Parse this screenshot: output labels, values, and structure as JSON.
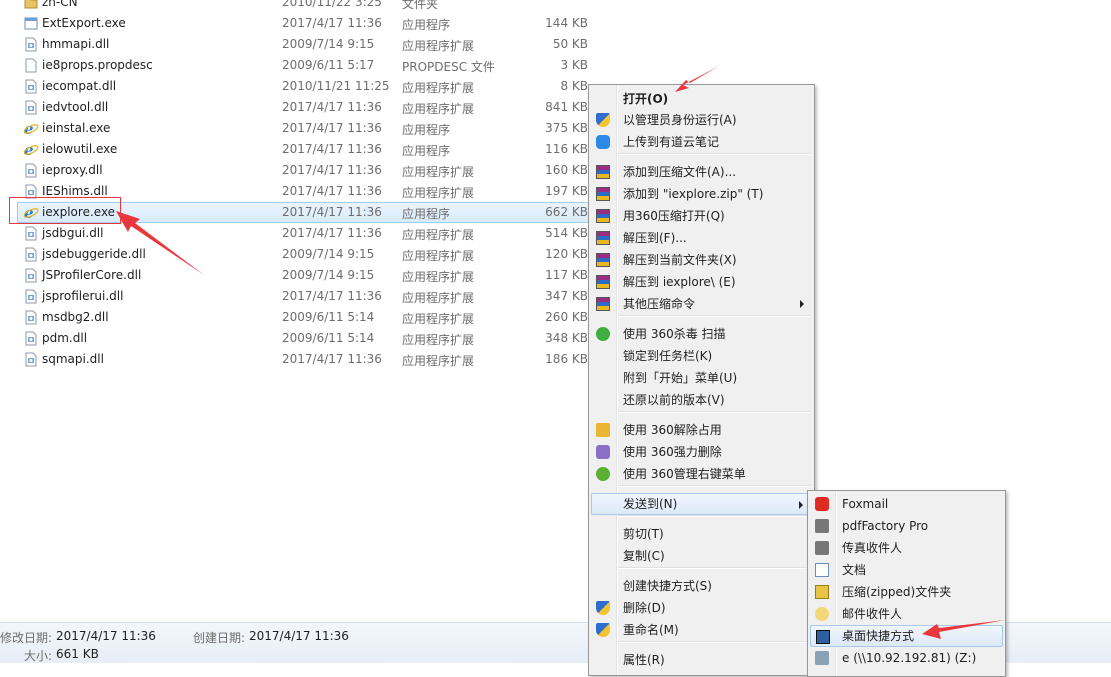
{
  "files": [
    {
      "name": "zh-CN",
      "date": "2010/11/22 3:25",
      "type": "文件夹",
      "size": "",
      "icon": "folder-icon"
    },
    {
      "name": "ExtExport.exe",
      "date": "2017/4/17 11:36",
      "type": "应用程序",
      "size": "144 KB",
      "icon": "exe-icon"
    },
    {
      "name": "hmmapi.dll",
      "date": "2009/7/14 9:15",
      "type": "应用程序扩展",
      "size": "50 KB",
      "icon": "dll-icon"
    },
    {
      "name": "ie8props.propdesc",
      "date": "2009/6/11 5:17",
      "type": "PROPDESC 文件",
      "size": "3 KB",
      "icon": "file-icon"
    },
    {
      "name": "iecompat.dll",
      "date": "2010/11/21 11:25",
      "type": "应用程序扩展",
      "size": "8 KB",
      "icon": "dll-icon"
    },
    {
      "name": "iedvtool.dll",
      "date": "2017/4/17 11:36",
      "type": "应用程序扩展",
      "size": "841 KB",
      "icon": "dll-icon"
    },
    {
      "name": "ieinstal.exe",
      "date": "2017/4/17 11:36",
      "type": "应用程序",
      "size": "375 KB",
      "icon": "ie-icon"
    },
    {
      "name": "ielowutil.exe",
      "date": "2017/4/17 11:36",
      "type": "应用程序",
      "size": "116 KB",
      "icon": "ie-icon"
    },
    {
      "name": "ieproxy.dll",
      "date": "2017/4/17 11:36",
      "type": "应用程序扩展",
      "size": "160 KB",
      "icon": "dll-icon"
    },
    {
      "name": "IEShims.dll",
      "date": "2017/4/17 11:36",
      "type": "应用程序扩展",
      "size": "197 KB",
      "icon": "dll-icon"
    },
    {
      "name": "iexplore.exe",
      "date": "2017/4/17 11:36",
      "type": "应用程序",
      "size": "662 KB",
      "icon": "ie-icon",
      "selected": true
    },
    {
      "name": "jsdbgui.dll",
      "date": "2017/4/17 11:36",
      "type": "应用程序扩展",
      "size": "514 KB",
      "icon": "dll-icon"
    },
    {
      "name": "jsdebuggeride.dll",
      "date": "2009/7/14 9:15",
      "type": "应用程序扩展",
      "size": "120 KB",
      "icon": "dll-icon"
    },
    {
      "name": "JSProfilerCore.dll",
      "date": "2009/7/14 9:15",
      "type": "应用程序扩展",
      "size": "117 KB",
      "icon": "dll-icon"
    },
    {
      "name": "jsprofilerui.dll",
      "date": "2017/4/17 11:36",
      "type": "应用程序扩展",
      "size": "347 KB",
      "icon": "dll-icon"
    },
    {
      "name": "msdbg2.dll",
      "date": "2009/6/11 5:14",
      "type": "应用程序扩展",
      "size": "260 KB",
      "icon": "dll-icon"
    },
    {
      "name": "pdm.dll",
      "date": "2009/6/11 5:14",
      "type": "应用程序扩展",
      "size": "348 KB",
      "icon": "dll-icon"
    },
    {
      "name": "sqmapi.dll",
      "date": "2017/4/17 11:36",
      "type": "应用程序扩展",
      "size": "186 KB",
      "icon": "dll-icon"
    }
  ],
  "status": {
    "modified_label": "修改日期:",
    "modified_value": "2017/4/17 11:36",
    "created_label": "创建日期:",
    "created_value": "2017/4/17 11:36",
    "size_label": "大小:",
    "size_value": "661 KB"
  },
  "context_menu": {
    "items": [
      {
        "label": "打开(O)",
        "bold": true,
        "icon": ""
      },
      {
        "label": "以管理员身份运行(A)",
        "icon": "uac-shield-icon"
      },
      {
        "label": "上传到有道云笔记",
        "icon": "youdao-note-icon"
      },
      {
        "label": "添加到压缩文件(A)...",
        "icon": "winrar-icon"
      },
      {
        "label": "添加到 \"iexplore.zip\" (T)",
        "icon": "winrar-icon"
      },
      {
        "label": "用360压缩打开(Q)",
        "icon": "winrar-icon"
      },
      {
        "label": "解压到(F)...",
        "icon": "winrar-icon"
      },
      {
        "label": "解压到当前文件夹(X)",
        "icon": "winrar-icon"
      },
      {
        "label": "解压到 iexplore\\ (E)",
        "icon": "winrar-icon"
      },
      {
        "label": "其他压缩命令",
        "icon": "winrar-icon",
        "submenu": true
      },
      {
        "label": "使用 360杀毒 扫描",
        "icon": "360-antivirus-icon"
      },
      {
        "label": "锁定到任务栏(K)",
        "icon": ""
      },
      {
        "label": "附到「开始」菜单(U)",
        "icon": ""
      },
      {
        "label": "还原以前的版本(V)",
        "icon": ""
      },
      {
        "label": "使用 360解除占用",
        "icon": "360-unlock-icon"
      },
      {
        "label": "使用 360强力删除",
        "icon": "360-delete-icon"
      },
      {
        "label": "使用 360管理右键菜单",
        "icon": "360-menu-icon"
      },
      {
        "label": "发送到(N)",
        "icon": "",
        "submenu": true,
        "hover": true
      },
      {
        "label": "剪切(T)",
        "icon": ""
      },
      {
        "label": "复制(C)",
        "icon": ""
      },
      {
        "label": "创建快捷方式(S)",
        "icon": ""
      },
      {
        "label": "删除(D)",
        "icon": "uac-shield-icon"
      },
      {
        "label": "重命名(M)",
        "icon": "uac-shield-icon"
      },
      {
        "label": "属性(R)",
        "icon": ""
      }
    ]
  },
  "send_to_menu": {
    "items": [
      {
        "label": "Foxmail",
        "icon": "foxmail-icon"
      },
      {
        "label": "pdfFactory Pro",
        "icon": "printer-icon"
      },
      {
        "label": "传真收件人",
        "icon": "fax-icon"
      },
      {
        "label": "文档",
        "icon": "document-icon"
      },
      {
        "label": "压缩(zipped)文件夹",
        "icon": "zip-folder-icon"
      },
      {
        "label": "邮件收件人",
        "icon": "mail-icon"
      },
      {
        "label": "桌面快捷方式",
        "icon": "desktop-icon",
        "hover": true
      },
      {
        "label": "e (\\\\10.92.192.81) (Z:)",
        "icon": "network-drive-icon"
      }
    ]
  },
  "colors": {
    "selection": "#cce8ff",
    "annotation": "#e8383d",
    "menu_bg": "#f0f0f0"
  }
}
